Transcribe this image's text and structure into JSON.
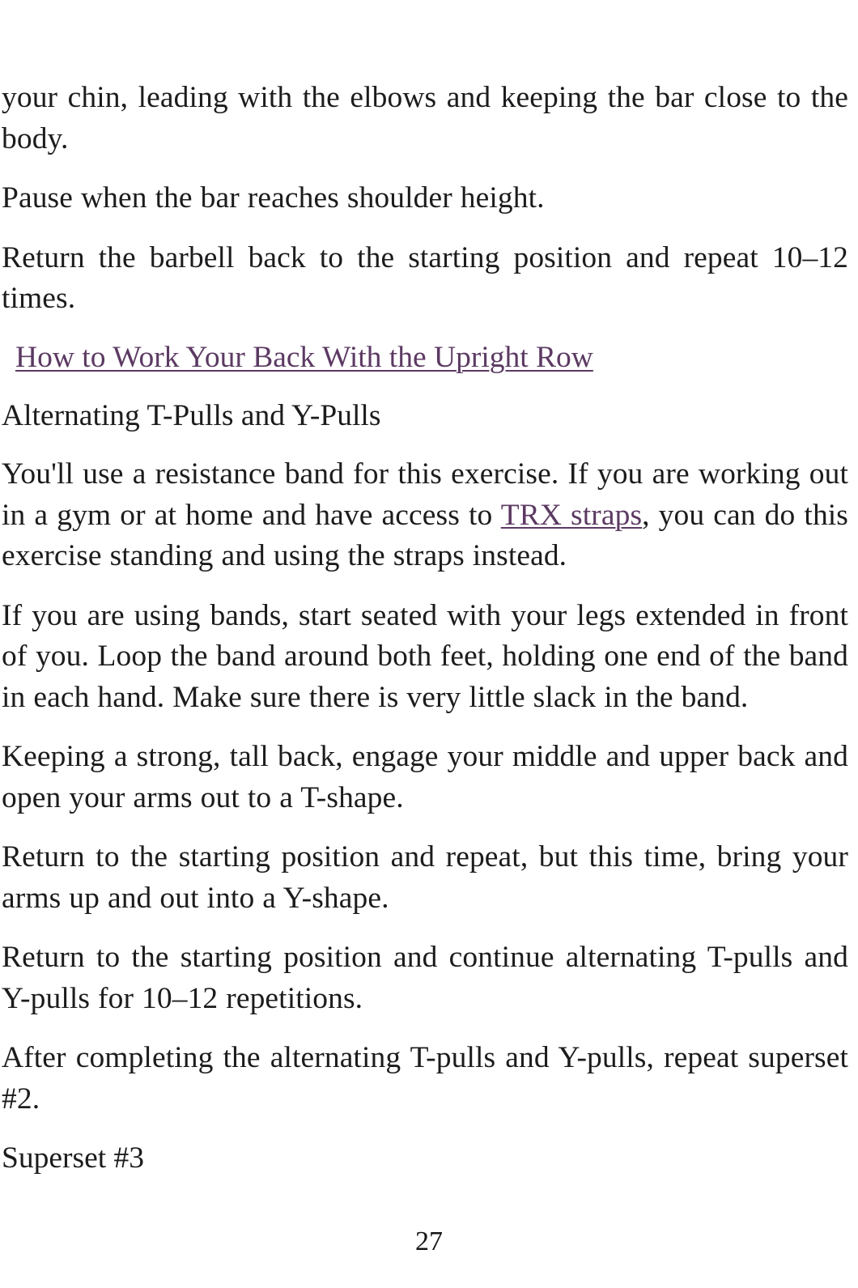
{
  "document": {
    "page_number": "27",
    "text_color": "#1c1c1e",
    "link_color": "#5c3a63",
    "background": "#ffffff"
  },
  "blocks": {
    "continued_paragraph": "your chin, leading with the elbows and keeping the bar close to the body.",
    "pause_paragraph": "Pause when the bar reaches shoulder height.",
    "return_barbell_paragraph": "Return the barbell back to the starting position and repeat 10–12 times.",
    "section_heading_link": "How to Work Your Back With the Upright Row",
    "exercise_subheading": "Alternating T-Pulls and Y-Pulls",
    "resistance_band_part1": "You'll use a resistance band for this exercise. If you are working out in a gym or at home and have access to ",
    "resistance_band_link": "TRX straps",
    "resistance_band_part2": ", you can do this exercise standing and using the straps instead.",
    "using_bands_paragraph": "If you are using bands, start seated with your legs extended in front of you. Loop the band around both feet, holding one end of the band in each hand. Make sure there is very little slack in the band.",
    "strong_back_paragraph": "Keeping a strong, tall back, engage your middle and upper back and open your arms out to a T-shape.",
    "y_shape_paragraph": "Return to the starting position and repeat, but this time, bring your arms up and out into a Y-shape.",
    "alternating_reps_paragraph": "Return to the starting position and continue alternating T-pulls and Y-pulls for 10–12 repetitions.",
    "repeat_superset_paragraph": "After completing the alternating T-pulls and Y-pulls, repeat superset #2.",
    "superset_label": "Superset #3"
  }
}
